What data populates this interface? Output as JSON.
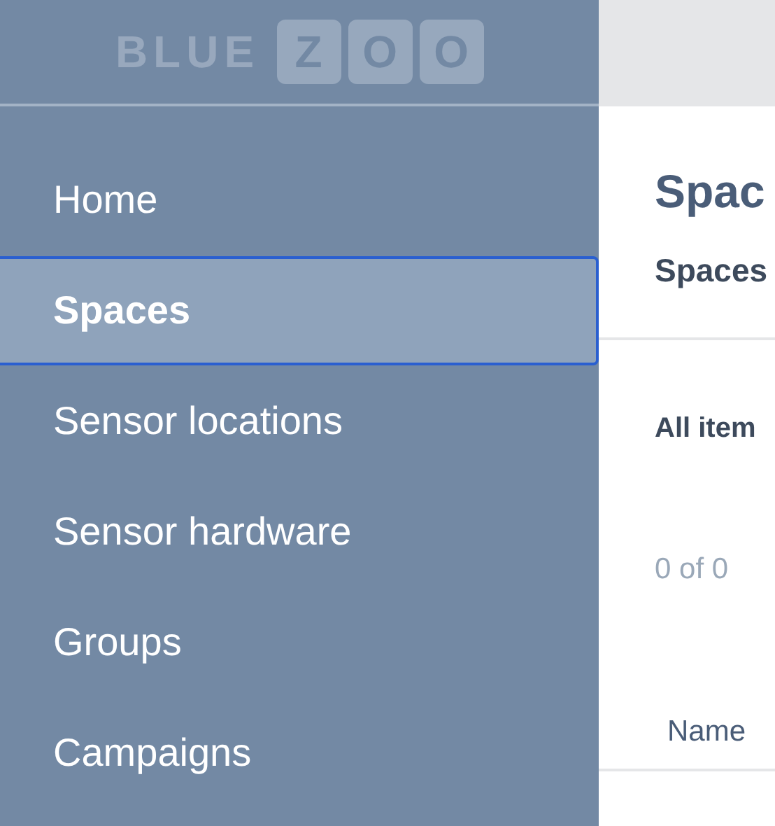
{
  "logo": {
    "word": "BLUE",
    "tiles": [
      "Z",
      "O",
      "O"
    ]
  },
  "sidebar": {
    "items": [
      {
        "label": "Home",
        "selected": false
      },
      {
        "label": "Spaces",
        "selected": true
      },
      {
        "label": "Sensor locations",
        "selected": false
      },
      {
        "label": "Sensor hardware",
        "selected": false
      },
      {
        "label": "Groups",
        "selected": false
      },
      {
        "label": "Campaigns",
        "selected": false
      }
    ]
  },
  "main": {
    "title": "Spac",
    "subtitle": "Spaces",
    "filter_label": "All item",
    "count": "0 of 0",
    "table": {
      "columns": [
        "Name"
      ]
    }
  }
}
